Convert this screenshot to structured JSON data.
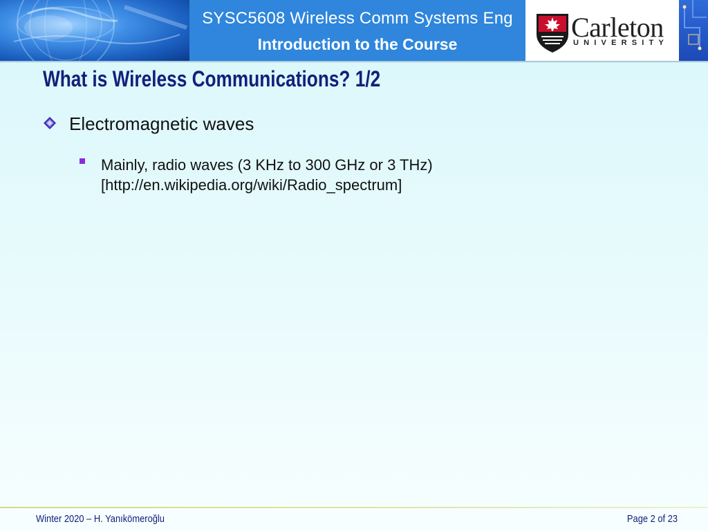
{
  "header": {
    "course_title": "SYSC5608 Wireless Comm Systems Eng",
    "course_subtitle": "Introduction to the Course",
    "logo_word": "Carleton",
    "logo_university": "UNIVERSITY"
  },
  "slide": {
    "title": "What is Wireless Communications? 1/2",
    "bullets": [
      {
        "text": "Electromagnetic waves",
        "sub": [
          {
            "line1": "Mainly, radio waves (3 KHz to 300 GHz or 3 THz)",
            "line2": "[http://en.wikipedia.org/wiki/Radio_spectrum]"
          }
        ]
      }
    ]
  },
  "footer": {
    "left": "Winter 2020 – H. Yanıkömeroğlu",
    "right": "Page 2 of 23"
  },
  "colors": {
    "title": "#13207a",
    "header_blue": "#2f86dc",
    "sub_bullet": "#8a2be2",
    "logo_red": "#c8102e"
  }
}
